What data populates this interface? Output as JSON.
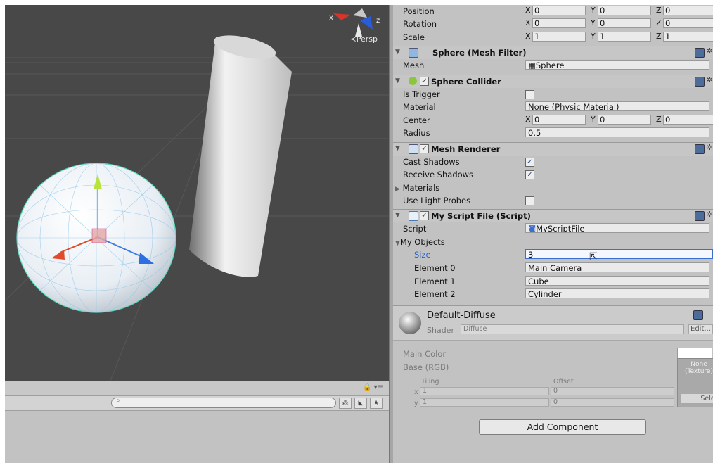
{
  "scene": {
    "persp_label": "≺Persp",
    "gizmo_x": "x",
    "gizmo_z": "z"
  },
  "hierarchy": {
    "search_placeholder": ""
  },
  "transform": {
    "position": {
      "label": "Position",
      "x": "0",
      "y": "0",
      "z": "0"
    },
    "rotation": {
      "label": "Rotation",
      "x": "0",
      "y": "0",
      "z": "0"
    },
    "scale": {
      "label": "Scale",
      "x": "1",
      "y": "1",
      "z": "1"
    }
  },
  "mesh_filter": {
    "title": "Sphere (Mesh Filter)",
    "mesh_label": "Mesh",
    "mesh_value": "Sphere"
  },
  "sphere_collider": {
    "title": "Sphere Collider",
    "is_trigger_label": "Is Trigger",
    "material_label": "Material",
    "material_value": "None (Physic Material)",
    "center_label": "Center",
    "center": {
      "x": "0",
      "y": "0",
      "z": "0"
    },
    "radius_label": "Radius",
    "radius_value": "0.5"
  },
  "mesh_renderer": {
    "title": "Mesh Renderer",
    "cast_shadows_label": "Cast Shadows",
    "receive_shadows_label": "Receive Shadows",
    "materials_label": "Materials",
    "light_probes_label": "Use Light Probes"
  },
  "script": {
    "title": "My Script File (Script)",
    "script_label": "Script",
    "script_value": "MyScriptFile",
    "objects_label": "My Objects",
    "size_label": "Size",
    "size_value": "3",
    "elements": [
      {
        "label": "Element 0",
        "value": "Main Camera"
      },
      {
        "label": "Element 1",
        "value": "Cube"
      },
      {
        "label": "Element 2",
        "value": "Cylinder"
      }
    ]
  },
  "material": {
    "name": "Default-Diffuse",
    "shader_label": "Shader",
    "shader_value": "Diffuse",
    "edit_label": "Edit...",
    "main_color_label": "Main Color",
    "base_label": "Base (RGB)",
    "tiling_label": "Tiling",
    "offset_label": "Offset",
    "x_label": "x",
    "y_label": "y",
    "tiling_x": "1",
    "tiling_y": "1",
    "offset_x": "0",
    "offset_y": "0",
    "texture_none": "None",
    "texture_type": "(Texture)",
    "select_label": "Selec"
  },
  "add_component_label": "Add Component",
  "colors": {
    "accent": "#3a6fd1",
    "panel": "#c2c2c2",
    "scene_bg": "#484848"
  }
}
